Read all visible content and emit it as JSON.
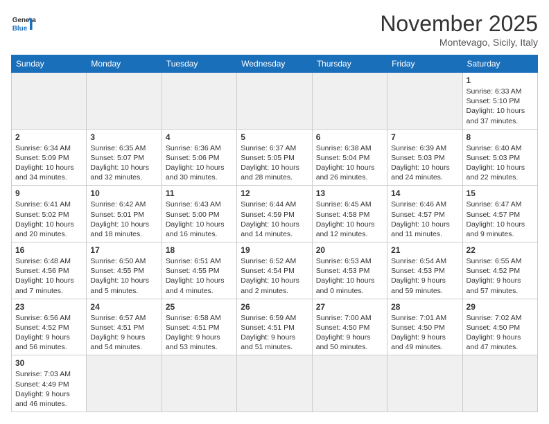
{
  "header": {
    "logo_general": "General",
    "logo_blue": "Blue",
    "month_title": "November 2025",
    "subtitle": "Montevago, Sicily, Italy"
  },
  "weekdays": [
    "Sunday",
    "Monday",
    "Tuesday",
    "Wednesday",
    "Thursday",
    "Friday",
    "Saturday"
  ],
  "weeks": [
    [
      {
        "day": "",
        "info": "",
        "empty": true
      },
      {
        "day": "",
        "info": "",
        "empty": true
      },
      {
        "day": "",
        "info": "",
        "empty": true
      },
      {
        "day": "",
        "info": "",
        "empty": true
      },
      {
        "day": "",
        "info": "",
        "empty": true
      },
      {
        "day": "",
        "info": "",
        "empty": true
      },
      {
        "day": "1",
        "info": "Sunrise: 6:33 AM\nSunset: 5:10 PM\nDaylight: 10 hours\nand 37 minutes."
      }
    ],
    [
      {
        "day": "2",
        "info": "Sunrise: 6:34 AM\nSunset: 5:09 PM\nDaylight: 10 hours\nand 34 minutes."
      },
      {
        "day": "3",
        "info": "Sunrise: 6:35 AM\nSunset: 5:07 PM\nDaylight: 10 hours\nand 32 minutes."
      },
      {
        "day": "4",
        "info": "Sunrise: 6:36 AM\nSunset: 5:06 PM\nDaylight: 10 hours\nand 30 minutes."
      },
      {
        "day": "5",
        "info": "Sunrise: 6:37 AM\nSunset: 5:05 PM\nDaylight: 10 hours\nand 28 minutes."
      },
      {
        "day": "6",
        "info": "Sunrise: 6:38 AM\nSunset: 5:04 PM\nDaylight: 10 hours\nand 26 minutes."
      },
      {
        "day": "7",
        "info": "Sunrise: 6:39 AM\nSunset: 5:03 PM\nDaylight: 10 hours\nand 24 minutes."
      },
      {
        "day": "8",
        "info": "Sunrise: 6:40 AM\nSunset: 5:03 PM\nDaylight: 10 hours\nand 22 minutes."
      }
    ],
    [
      {
        "day": "9",
        "info": "Sunrise: 6:41 AM\nSunset: 5:02 PM\nDaylight: 10 hours\nand 20 minutes."
      },
      {
        "day": "10",
        "info": "Sunrise: 6:42 AM\nSunset: 5:01 PM\nDaylight: 10 hours\nand 18 minutes."
      },
      {
        "day": "11",
        "info": "Sunrise: 6:43 AM\nSunset: 5:00 PM\nDaylight: 10 hours\nand 16 minutes."
      },
      {
        "day": "12",
        "info": "Sunrise: 6:44 AM\nSunset: 4:59 PM\nDaylight: 10 hours\nand 14 minutes."
      },
      {
        "day": "13",
        "info": "Sunrise: 6:45 AM\nSunset: 4:58 PM\nDaylight: 10 hours\nand 12 minutes."
      },
      {
        "day": "14",
        "info": "Sunrise: 6:46 AM\nSunset: 4:57 PM\nDaylight: 10 hours\nand 11 minutes."
      },
      {
        "day": "15",
        "info": "Sunrise: 6:47 AM\nSunset: 4:57 PM\nDaylight: 10 hours\nand 9 minutes."
      }
    ],
    [
      {
        "day": "16",
        "info": "Sunrise: 6:48 AM\nSunset: 4:56 PM\nDaylight: 10 hours\nand 7 minutes."
      },
      {
        "day": "17",
        "info": "Sunrise: 6:50 AM\nSunset: 4:55 PM\nDaylight: 10 hours\nand 5 minutes."
      },
      {
        "day": "18",
        "info": "Sunrise: 6:51 AM\nSunset: 4:55 PM\nDaylight: 10 hours\nand 4 minutes."
      },
      {
        "day": "19",
        "info": "Sunrise: 6:52 AM\nSunset: 4:54 PM\nDaylight: 10 hours\nand 2 minutes."
      },
      {
        "day": "20",
        "info": "Sunrise: 6:53 AM\nSunset: 4:53 PM\nDaylight: 10 hours\nand 0 minutes."
      },
      {
        "day": "21",
        "info": "Sunrise: 6:54 AM\nSunset: 4:53 PM\nDaylight: 9 hours\nand 59 minutes."
      },
      {
        "day": "22",
        "info": "Sunrise: 6:55 AM\nSunset: 4:52 PM\nDaylight: 9 hours\nand 57 minutes."
      }
    ],
    [
      {
        "day": "23",
        "info": "Sunrise: 6:56 AM\nSunset: 4:52 PM\nDaylight: 9 hours\nand 56 minutes."
      },
      {
        "day": "24",
        "info": "Sunrise: 6:57 AM\nSunset: 4:51 PM\nDaylight: 9 hours\nand 54 minutes."
      },
      {
        "day": "25",
        "info": "Sunrise: 6:58 AM\nSunset: 4:51 PM\nDaylight: 9 hours\nand 53 minutes."
      },
      {
        "day": "26",
        "info": "Sunrise: 6:59 AM\nSunset: 4:51 PM\nDaylight: 9 hours\nand 51 minutes."
      },
      {
        "day": "27",
        "info": "Sunrise: 7:00 AM\nSunset: 4:50 PM\nDaylight: 9 hours\nand 50 minutes."
      },
      {
        "day": "28",
        "info": "Sunrise: 7:01 AM\nSunset: 4:50 PM\nDaylight: 9 hours\nand 49 minutes."
      },
      {
        "day": "29",
        "info": "Sunrise: 7:02 AM\nSunset: 4:50 PM\nDaylight: 9 hours\nand 47 minutes."
      }
    ],
    [
      {
        "day": "30",
        "info": "Sunrise: 7:03 AM\nSunset: 4:49 PM\nDaylight: 9 hours\nand 46 minutes."
      },
      {
        "day": "",
        "info": "",
        "empty": true
      },
      {
        "day": "",
        "info": "",
        "empty": true
      },
      {
        "day": "",
        "info": "",
        "empty": true
      },
      {
        "day": "",
        "info": "",
        "empty": true
      },
      {
        "day": "",
        "info": "",
        "empty": true
      },
      {
        "day": "",
        "info": "",
        "empty": true
      }
    ]
  ]
}
